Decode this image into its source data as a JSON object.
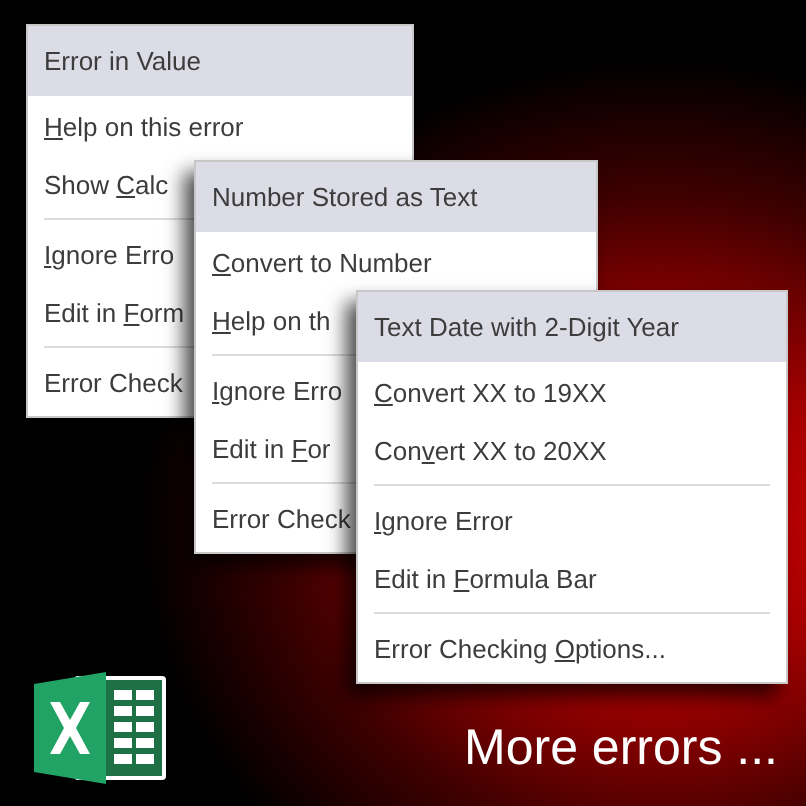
{
  "menus": [
    {
      "title": "Error in Value",
      "items": [
        {
          "kind": "item",
          "key": "H",
          "post": "elp on this error"
        },
        {
          "kind": "item",
          "pre": "Show ",
          "key": "C",
          "post": "alc"
        },
        {
          "kind": "separator"
        },
        {
          "kind": "item",
          "key": "I",
          "post": "gnore Erro"
        },
        {
          "kind": "item",
          "pre": "Edit in ",
          "key": "F",
          "post": "orm"
        },
        {
          "kind": "separator"
        },
        {
          "kind": "item",
          "pre": "Error Check"
        }
      ]
    },
    {
      "title": "Number Stored as Text",
      "items": [
        {
          "kind": "item",
          "key": "C",
          "post": "onvert to Number"
        },
        {
          "kind": "item",
          "key": "H",
          "post": "elp on th"
        },
        {
          "kind": "separator"
        },
        {
          "kind": "item",
          "key": "I",
          "post": "gnore Erro"
        },
        {
          "kind": "item",
          "pre": "Edit in ",
          "key": "F",
          "post": "or"
        },
        {
          "kind": "separator"
        },
        {
          "kind": "item",
          "pre": "Error Check"
        }
      ]
    },
    {
      "title": "Text Date with 2-Digit Year",
      "items": [
        {
          "kind": "item",
          "key": "C",
          "post": "onvert XX to 19XX"
        },
        {
          "kind": "item",
          "pre": "Con",
          "key": "v",
          "post": "ert XX to 20XX"
        },
        {
          "kind": "separator"
        },
        {
          "kind": "item",
          "key": "I",
          "post": "gnore Error"
        },
        {
          "kind": "item",
          "pre": "Edit in ",
          "key": "F",
          "post": "ormula Bar"
        },
        {
          "kind": "separator"
        },
        {
          "kind": "item",
          "pre": "Error Checking ",
          "key": "O",
          "post": "ptions..."
        }
      ]
    }
  ],
  "caption": "More errors ..."
}
